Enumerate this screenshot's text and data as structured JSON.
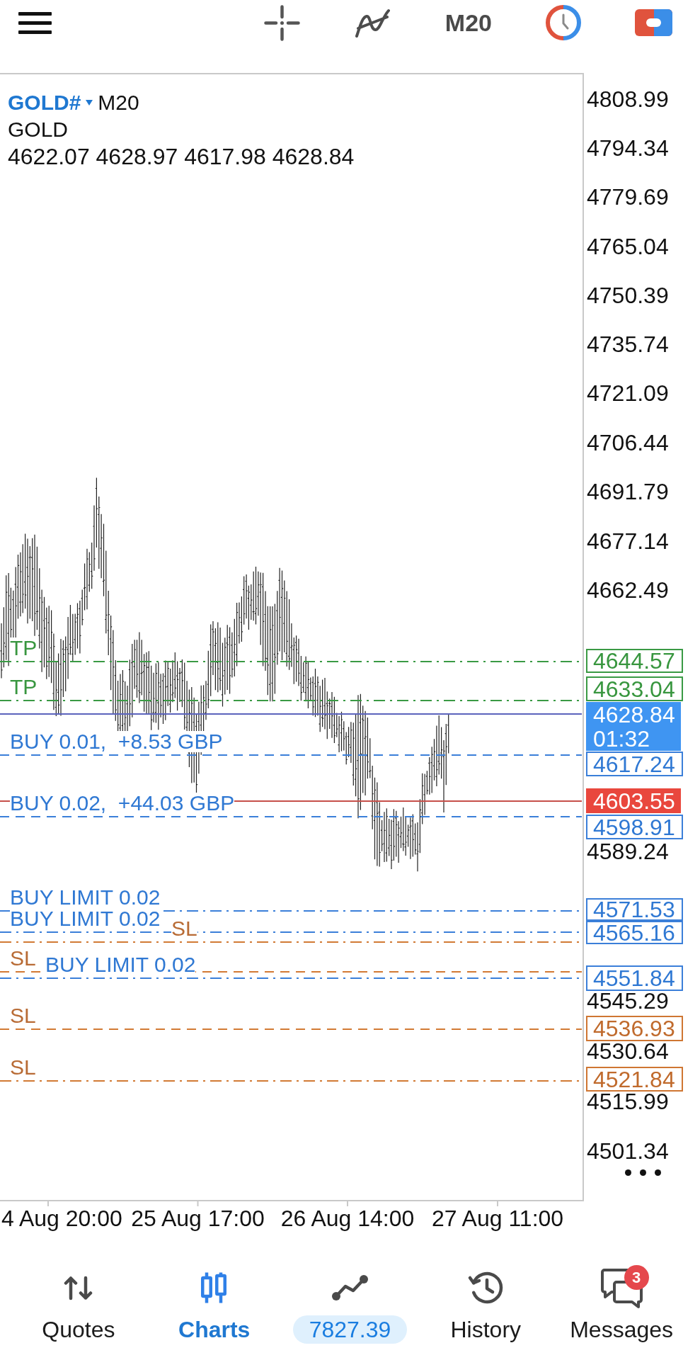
{
  "toolbar": {
    "timeframe": "M20"
  },
  "chart": {
    "symbol": "GOLD#",
    "timeframe": "M20",
    "description": "GOLD",
    "ohlc": "4622.07 4628.97 4617.98 4628.84",
    "price_axis": [
      "4808.99",
      "4794.34",
      "4779.69",
      "4765.04",
      "4750.39",
      "4735.74",
      "4721.09",
      "4706.44",
      "4691.79",
      "4677.14",
      "4662.49",
      "4589.24",
      "4545.29",
      "4530.64",
      "4515.99",
      "4501.34"
    ],
    "lines": [
      {
        "kind": "take_profit",
        "pending": true,
        "label": "TP",
        "price": "4644.57"
      },
      {
        "kind": "take_profit",
        "pending": true,
        "label": "TP",
        "price": "4633.04"
      },
      {
        "kind": "current",
        "pending": false,
        "price": "4628.84",
        "timer": "01:32"
      },
      {
        "kind": "position",
        "pending": false,
        "label": "BUY 0.01,  +8.53 GBP",
        "price": "4617.24"
      },
      {
        "kind": "price_level",
        "pending": false,
        "price": "4603.55"
      },
      {
        "kind": "position",
        "pending": false,
        "label": "BUY 0.02,  +44.03 GBP",
        "price": "4598.91"
      },
      {
        "kind": "buy_limit",
        "pending": true,
        "label": "BUY LIMIT 0.02",
        "price": "4571.53"
      },
      {
        "kind": "buy_limit",
        "pending": true,
        "label": "BUY LIMIT 0.02",
        "price": "4565.16"
      },
      {
        "kind": "stop_loss",
        "pending": true,
        "label": "SL"
      },
      {
        "kind": "stop_loss",
        "pending": false,
        "label": "SL"
      },
      {
        "kind": "buy_limit",
        "pending": true,
        "label": "BUY LIMIT 0.02",
        "price": "4551.84"
      },
      {
        "kind": "stop_loss",
        "pending": false,
        "label": "SL",
        "price": "4536.93"
      },
      {
        "kind": "stop_loss",
        "pending": true,
        "label": "SL",
        "price": "4521.84"
      }
    ],
    "time_axis": [
      "4 Aug 20:00",
      "25 Aug 17:00",
      "26 Aug 14:00",
      "27 Aug 11:00"
    ]
  },
  "nav": [
    {
      "kind": "tab",
      "label": "Quotes",
      "selected": false
    },
    {
      "kind": "tab",
      "label": "Charts",
      "selected": true
    },
    {
      "kind": "balance",
      "label": "7827.39",
      "selected": false
    },
    {
      "kind": "tab",
      "label": "History",
      "selected": false
    },
    {
      "kind": "tab",
      "label": "Messages",
      "selected": false,
      "badge": "3"
    }
  ]
}
